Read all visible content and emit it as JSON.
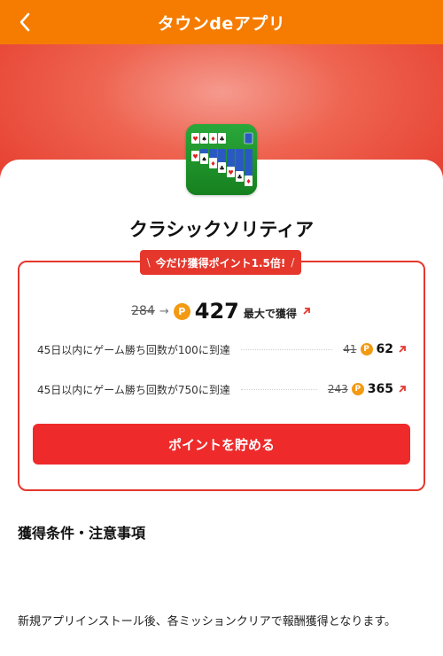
{
  "header": {
    "title": "タウンdeアプリ",
    "back_icon": "chevron-left-icon"
  },
  "colors": {
    "header": "#f57c00",
    "accent_red": "#e5372c",
    "coin": "#f39a12",
    "button": "#ee2a2a"
  },
  "app": {
    "name": "クラシックソリティア",
    "icon": "solitaire-app-icon"
  },
  "promo": {
    "badge_text": "今だけ獲得ポイント1.5倍!",
    "slash_left": "\\",
    "slash_right": "/"
  },
  "points": {
    "old": "284",
    "arrow": "→",
    "coin": "P",
    "new": "427",
    "suffix": "最大で獲得"
  },
  "missions": [
    {
      "label": "45日以内にゲーム勝ち回数が100に到達",
      "old": "41",
      "coin": "P",
      "new": "62"
    },
    {
      "label": "45日以内にゲーム勝ち回数が750に到達",
      "old": "243",
      "coin": "P",
      "new": "365"
    }
  ],
  "cta": {
    "label": "ポイントを貯める"
  },
  "conditions": {
    "title": "獲得条件・注意事項",
    "text": "新規アプリインストール後、各ミッションクリアで報酬獲得となります。"
  }
}
